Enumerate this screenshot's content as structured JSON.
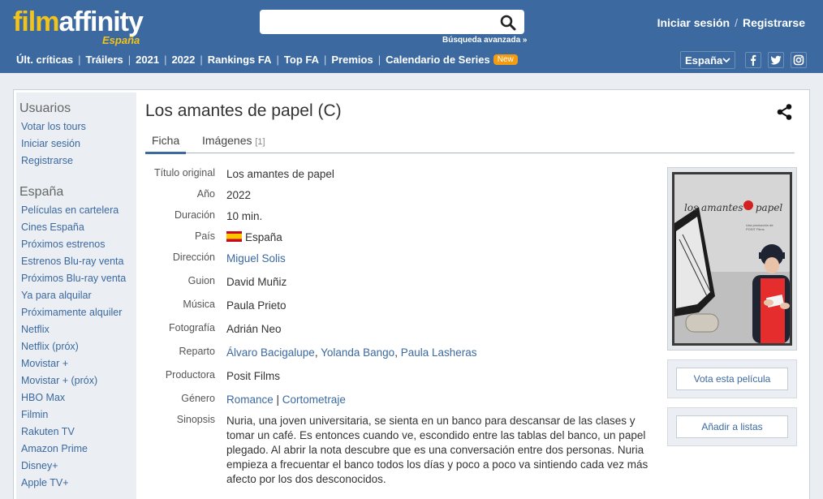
{
  "header": {
    "logo_film": "film",
    "logo_affinity": "affinity",
    "logo_country": "España",
    "search": {
      "value": "",
      "placeholder": ""
    },
    "advanced_search": "Búsqueda avanzada »",
    "login": "Iniciar sesión",
    "separator": "/",
    "register": "Registrarse",
    "nav": [
      "Últ. críticas",
      "Tráilers",
      "2021",
      "2022",
      "Rankings FA",
      "Top FA",
      "Premios",
      "Calendario de Series"
    ],
    "new_badge": "New",
    "country_select": "España",
    "colors": {
      "header_bg": "#3b69a0",
      "logo_yellow": "#f2c31a",
      "badge": "#f39c12"
    }
  },
  "sidebar": {
    "users_heading": "Usuarios",
    "users_links": [
      "Votar los tours",
      "Iniciar sesión",
      "Registrarse"
    ],
    "spain_heading": "España",
    "spain_links": [
      "Películas en cartelera",
      "Cines España",
      "Próximos estrenos",
      "Estrenos Blu-ray venta",
      "Próximos Blu-ray venta",
      "Ya para alquilar",
      "Próximamente alquiler",
      "Netflix",
      "Netflix (próx)",
      "Movistar +",
      "Movistar + (próx)",
      "HBO Max",
      "Filmin",
      "Rakuten TV",
      "Amazon Prime",
      "Disney+",
      "Apple TV+"
    ]
  },
  "movie": {
    "title": "Los amantes de papel (C)",
    "tabs": {
      "ficha": "Ficha",
      "imagenes": "Imágenes",
      "imagenes_count": "[1]"
    },
    "labels": {
      "titulo_original": "Título original",
      "anio": "Año",
      "duracion": "Duración",
      "pais": "País",
      "direccion": "Dirección",
      "guion": "Guion",
      "musica": "Música",
      "fotografia": "Fotografía",
      "reparto": "Reparto",
      "productora": "Productora",
      "genero": "Género",
      "sinopsis": "Sinopsis"
    },
    "values": {
      "titulo_original": "Los amantes de papel",
      "anio": "2022",
      "duracion": "10 min.",
      "pais": "España",
      "direccion": "Miguel Solis",
      "guion": "David Muñiz",
      "musica": "Paula Prieto",
      "fotografia": "Adrián Neo",
      "reparto": [
        "Álvaro Bacigalupe",
        "Yolanda Bango",
        "Paula Lasheras"
      ],
      "productora": "Posit Films",
      "genero": [
        "Romance",
        "Cortometraje"
      ],
      "sinopsis": "Nuria, una joven universitaria, se sienta en un banco para descansar de las clases y tomar un café. Es entonces cuando ve, escondido entre las tablas del banco, un papel plegado. Al abrir la nota descubre que es una conversación entre dos personas. Nuria empieza a frecuentar el banco todos los días y poco a poco va sintiendo cada vez más afecto por los dos desconocidos."
    },
    "poster": {
      "title_left": "los amantes",
      "title_right": "papel",
      "subtitle": "Una producción de POSIT Films"
    },
    "vote_button": "Vota esta película",
    "add_list_button": "Añadir a listas"
  }
}
